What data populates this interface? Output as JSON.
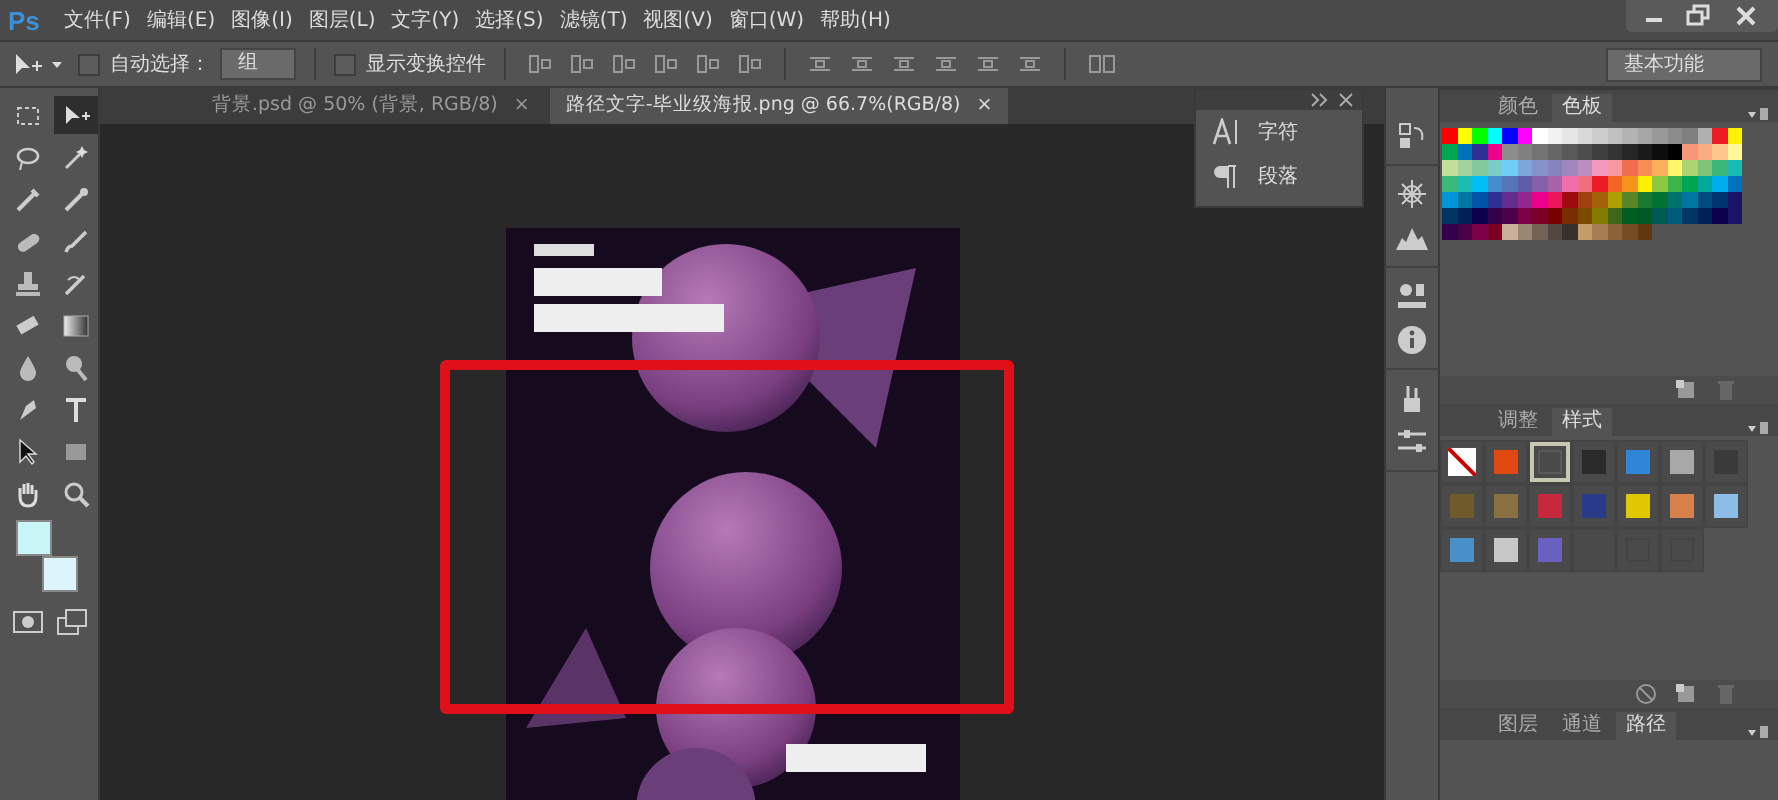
{
  "app_logo": "Ps",
  "menu": [
    "文件(F)",
    "编辑(E)",
    "图像(I)",
    "图层(L)",
    "文字(Y)",
    "选择(S)",
    "滤镜(T)",
    "视图(V)",
    "窗口(W)",
    "帮助(H)"
  ],
  "options_bar": {
    "auto_select": {
      "label": "自动选择：",
      "checked": false
    },
    "auto_select_target": "组",
    "show_transform": {
      "label": "显示变换控件",
      "checked": false
    },
    "workspace": "基本功能"
  },
  "doc_tabs": [
    {
      "label": "背景.psd @ 50% (背景, RGB/8)",
      "close": "×",
      "selected": false
    },
    {
      "label": "路径文字-毕业级海报.png @ 66.7%(RGB/8)",
      "close": "×",
      "selected": true
    }
  ],
  "tools": [
    {
      "kind": "marquee",
      "selected": false
    },
    {
      "kind": "move",
      "selected": true
    },
    {
      "kind": "lasso",
      "selected": false
    },
    {
      "kind": "wand",
      "selected": false
    },
    {
      "kind": "crop",
      "selected": false
    },
    {
      "kind": "eyedropper",
      "selected": false
    },
    {
      "kind": "healing",
      "selected": false
    },
    {
      "kind": "brush",
      "selected": false
    },
    {
      "kind": "stamp",
      "selected": false
    },
    {
      "kind": "history",
      "selected": false
    },
    {
      "kind": "eraser",
      "selected": false
    },
    {
      "kind": "gradient",
      "selected": false
    },
    {
      "kind": "blur",
      "selected": false
    },
    {
      "kind": "dodge",
      "selected": false
    },
    {
      "kind": "pen",
      "selected": false
    },
    {
      "kind": "type",
      "selected": false
    },
    {
      "kind": "pointer",
      "selected": false
    },
    {
      "kind": "shape",
      "selected": false
    },
    {
      "kind": "hand",
      "selected": false
    },
    {
      "kind": "zoom",
      "selected": false
    }
  ],
  "color_picker": {
    "foreground": {
      "color": "#c8f6f6"
    },
    "background": {
      "color": "#dcf4fa"
    }
  },
  "float_panel": {
    "items": [
      {
        "kind": "character",
        "label": "字符"
      },
      {
        "kind": "paragraph",
        "label": "段落"
      }
    ]
  },
  "swatches_panel": {
    "tabs": [
      {
        "label": "颜色",
        "selected": false
      },
      {
        "label": "色板",
        "selected": true
      }
    ],
    "swatches": [
      {
        "color": "#ff0000"
      },
      {
        "color": "#ffff00"
      },
      {
        "color": "#00ff00"
      },
      {
        "color": "#00ffff"
      },
      {
        "color": "#0000ff"
      },
      {
        "color": "#ff00ff"
      },
      {
        "color": "#ffffff"
      },
      {
        "color": "#f2f2f2"
      },
      {
        "color": "#e6e6e6"
      },
      {
        "color": "#d9d9d9"
      },
      {
        "color": "#cccccc"
      },
      {
        "color": "#c0c0c0"
      },
      {
        "color": "#b3b3b3"
      },
      {
        "color": "#a6a6a6"
      },
      {
        "color": "#999999"
      },
      {
        "color": "#8c8c8c"
      },
      {
        "color": "#808080"
      },
      {
        "color": "#b0b0b0"
      },
      {
        "color": "#ed1c24"
      },
      {
        "color": "#fff200"
      },
      {
        "color": "#00a651"
      },
      {
        "color": "#0072bc"
      },
      {
        "color": "#2e3192"
      },
      {
        "color": "#ec008c"
      },
      {
        "color": "#8c8c8c"
      },
      {
        "color": "#808080"
      },
      {
        "color": "#737373"
      },
      {
        "color": "#666666"
      },
      {
        "color": "#595959"
      },
      {
        "color": "#4d4d4d"
      },
      {
        "color": "#404040"
      },
      {
        "color": "#333333"
      },
      {
        "color": "#262626"
      },
      {
        "color": "#1a1a1a"
      },
      {
        "color": "#0d0d0d"
      },
      {
        "color": "#000000"
      },
      {
        "color": "#f7977a"
      },
      {
        "color": "#f9ad81"
      },
      {
        "color": "#fdc68a"
      },
      {
        "color": "#fff79a"
      },
      {
        "color": "#c4df9b"
      },
      {
        "color": "#a3d39c"
      },
      {
        "color": "#82ca9c"
      },
      {
        "color": "#7accc8"
      },
      {
        "color": "#6dcff6"
      },
      {
        "color": "#7da7d9"
      },
      {
        "color": "#8493ca"
      },
      {
        "color": "#8882be"
      },
      {
        "color": "#a187be"
      },
      {
        "color": "#bc8dbf"
      },
      {
        "color": "#f49ac2"
      },
      {
        "color": "#f6989d"
      },
      {
        "color": "#f26c4f"
      },
      {
        "color": "#f68e56"
      },
      {
        "color": "#fbaf5d"
      },
      {
        "color": "#fff568"
      },
      {
        "color": "#acd372"
      },
      {
        "color": "#7cc576"
      },
      {
        "color": "#3bb878"
      },
      {
        "color": "#1abbb4"
      },
      {
        "color": "#3cb878"
      },
      {
        "color": "#1cbbb4"
      },
      {
        "color": "#00bff3"
      },
      {
        "color": "#448ccb"
      },
      {
        "color": "#5674b9"
      },
      {
        "color": "#605ca8"
      },
      {
        "color": "#855fa8"
      },
      {
        "color": "#a763a8"
      },
      {
        "color": "#f06eaa"
      },
      {
        "color": "#f26d7d"
      },
      {
        "color": "#ed1c24"
      },
      {
        "color": "#f26522"
      },
      {
        "color": "#f7941d"
      },
      {
        "color": "#fff200"
      },
      {
        "color": "#8dc63f"
      },
      {
        "color": "#39b54a"
      },
      {
        "color": "#00a651"
      },
      {
        "color": "#00a99d"
      },
      {
        "color": "#00aeef"
      },
      {
        "color": "#0072bc"
      },
      {
        "color": "#0095d9"
      },
      {
        "color": "#0076a3"
      },
      {
        "color": "#0054a6"
      },
      {
        "color": "#2e3192"
      },
      {
        "color": "#662d91"
      },
      {
        "color": "#92278f"
      },
      {
        "color": "#ec008c"
      },
      {
        "color": "#ed145b"
      },
      {
        "color": "#9e0b0f"
      },
      {
        "color": "#a0410d"
      },
      {
        "color": "#a36209"
      },
      {
        "color": "#aba000"
      },
      {
        "color": "#598527"
      },
      {
        "color": "#197b30"
      },
      {
        "color": "#007236"
      },
      {
        "color": "#00746b"
      },
      {
        "color": "#0076a3"
      },
      {
        "color": "#004b80"
      },
      {
        "color": "#003471"
      },
      {
        "color": "#1b1464"
      },
      {
        "color": "#003663"
      },
      {
        "color": "#002157"
      },
      {
        "color": "#0d004c"
      },
      {
        "color": "#32004b"
      },
      {
        "color": "#4b0049"
      },
      {
        "color": "#7b0046"
      },
      {
        "color": "#7a0026"
      },
      {
        "color": "#790000"
      },
      {
        "color": "#7b2e00"
      },
      {
        "color": "#7d4900"
      },
      {
        "color": "#827b00"
      },
      {
        "color": "#406618"
      },
      {
        "color": "#005e20"
      },
      {
        "color": "#005826"
      },
      {
        "color": "#005952"
      },
      {
        "color": "#005b7f"
      },
      {
        "color": "#003663"
      },
      {
        "color": "#002157"
      },
      {
        "color": "#0d004c"
      },
      {
        "color": "#1b1464"
      },
      {
        "color": "#32004b"
      },
      {
        "color": "#4b0049"
      },
      {
        "color": "#7b0046"
      },
      {
        "color": "#7a0026"
      },
      {
        "color": "#c7b299"
      },
      {
        "color": "#998675"
      },
      {
        "color": "#736357"
      },
      {
        "color": "#534741"
      },
      {
        "color": "#37302d"
      },
      {
        "color": "#c69c6d"
      },
      {
        "color": "#a67c52"
      },
      {
        "color": "#8c6239"
      },
      {
        "color": "#754c24"
      },
      {
        "color": "#603913"
      }
    ]
  },
  "styles_panel": {
    "tabs": [
      {
        "label": "调整",
        "selected": false
      },
      {
        "label": "样式",
        "selected": true
      }
    ],
    "styles": [
      {
        "kind": "none",
        "selected": false
      },
      {
        "kind": "fill",
        "color": "#e04a10",
        "selected": false
      },
      {
        "kind": "outline",
        "color": "#5a5a5a",
        "selected": true
      },
      {
        "kind": "fill",
        "color": "#2a2a2a",
        "selected": false
      },
      {
        "kind": "fill",
        "color": "#2f86d8",
        "selected": false
      },
      {
        "kind": "fill",
        "color": "#a8a8a8",
        "selected": false
      },
      {
        "kind": "fill",
        "color": "#3a3a3a",
        "selected": false
      },
      {
        "kind": "fill",
        "color": "#6e5a2a",
        "selected": false
      },
      {
        "kind": "fill",
        "color": "#8a7040",
        "selected": false
      },
      {
        "kind": "fill",
        "color": "#c8283c",
        "selected": false
      },
      {
        "kind": "fill",
        "color": "#2a3a8a",
        "selected": false
      },
      {
        "kind": "fill",
        "color": "#e0c800",
        "selected": false
      },
      {
        "kind": "fill",
        "color": "#d8804a",
        "selected": false
      },
      {
        "kind": "fill",
        "color": "#8cbce8",
        "selected": false
      },
      {
        "kind": "fill",
        "color": "#4a90c8",
        "selected": false
      },
      {
        "kind": "fill",
        "color": "#c8c8c8",
        "selected": false
      },
      {
        "kind": "fill",
        "color": "#6a60c0",
        "selected": false
      },
      {
        "kind": "outline",
        "color": "#4a4a4a",
        "selected": false
      },
      {
        "kind": "outline",
        "color": "#444444",
        "selected": false
      },
      {
        "kind": "outline",
        "color": "#444444",
        "selected": false
      }
    ]
  },
  "layers_panel": {
    "tabs": [
      {
        "label": "图层",
        "selected": false
      },
      {
        "label": "通道",
        "selected": false
      },
      {
        "label": "路径",
        "selected": true
      }
    ]
  }
}
